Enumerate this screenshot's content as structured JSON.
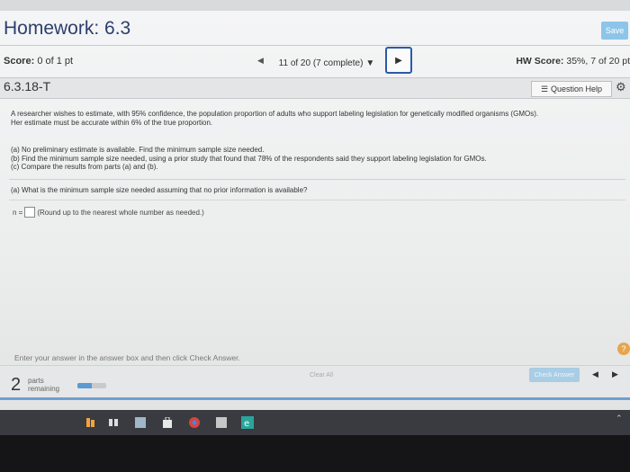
{
  "header": {
    "title": "Homework: 6.3",
    "save_label": "Save"
  },
  "nav": {
    "score_label": "Score:",
    "score_value": "0 of 1 pt",
    "prev_icon": "left-arrow",
    "status": "11 of 20 (7 complete)",
    "status_icon": "▼",
    "next_icon": "right-arrow",
    "hw_score_label": "HW Score:",
    "hw_score_value": "35%, 7 of 20 pt"
  },
  "question": {
    "id": "6.3.18-T",
    "help_label": "Question Help",
    "help_icon": "list-icon",
    "settings_icon": "gear-icon",
    "text_line1": "A researcher wishes to estimate, with 95% confidence, the population proportion of adults who support labeling legislation for genetically modified organisms (GMOs).",
    "text_line2": "Her estimate must be accurate within 6% of the true proportion.",
    "part_a": "(a) No preliminary estimate is available. Find the minimum sample size needed.",
    "part_b": "(b) Find the minimum sample size needed, using a prior study that found that 78% of the respondents said they support labeling legislation for GMOs.",
    "part_c": "(c) Compare the results from parts (a) and (b).",
    "sub_question": "(a) What is the minimum sample size needed assuming that no prior information is available?",
    "answer_prefix": "n =",
    "answer_value": "",
    "answer_hint": "(Round up to the nearest whole number as needed.)"
  },
  "footer": {
    "instruction": "Enter your answer in the answer box and then click Check Answer.",
    "help_circle": "?",
    "parts_count": "2",
    "parts_label_1": "parts",
    "parts_label_2": "remaining",
    "progress": 0.5,
    "clear_all": "Clear All",
    "check_answer": "Check Answer"
  },
  "colors": {
    "title": "#2c3e6e",
    "accent": "#2a5aa8",
    "progress": "#5b9bd1",
    "help_circle": "#e5a64a"
  }
}
